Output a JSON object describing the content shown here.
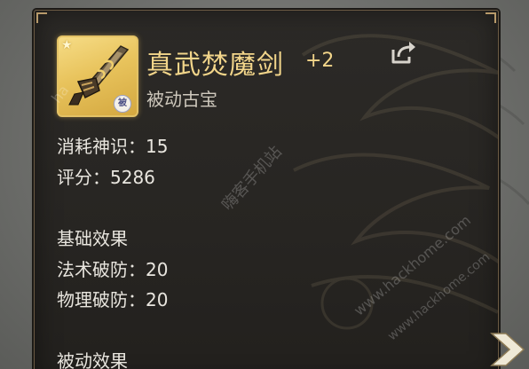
{
  "item": {
    "name": "真武焚魔剑",
    "level": "+2",
    "type": "被动古宝",
    "badge": "被",
    "quality_color": "#e3c266"
  },
  "stats": {
    "consume_label": "消耗神识：",
    "consume_value": "15",
    "score_label": "评分：",
    "score_value": "5286"
  },
  "basic_effects": {
    "title": "基础效果",
    "items": [
      {
        "label": "法术破防：",
        "value": "20"
      },
      {
        "label": "物理破防：",
        "value": "20"
      }
    ]
  },
  "passive_effects": {
    "title": "被动效果"
  },
  "watermark": {
    "cn": "嗨客手机站",
    "url1": "www.hackhome.com",
    "url2": "www.hackhome.com",
    "url3": "ha"
  },
  "icons": {
    "share": "share-icon",
    "next": "next-arrow-icon"
  },
  "colors": {
    "gold_text": "#f2d58a",
    "card_bg": "#2c2a27"
  }
}
